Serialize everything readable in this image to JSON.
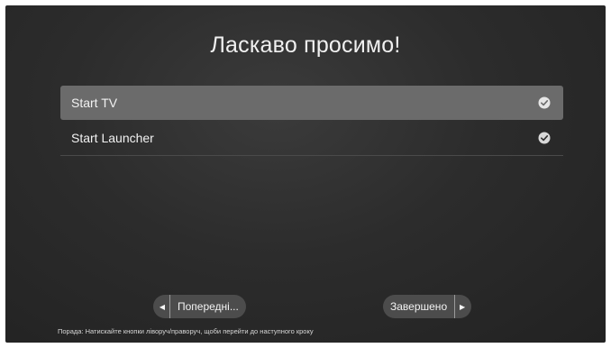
{
  "screen": {
    "title": "Ласкаво просимо!"
  },
  "options": [
    {
      "label": "Start TV",
      "focused": true
    },
    {
      "label": "Start Launcher",
      "focused": false
    }
  ],
  "navigation": {
    "previous_label": "Попередні...",
    "done_label": "Завершено"
  },
  "hint": "Порада: Натискайте кнопки ліворуч/праворуч, щоби перейти до наступного кроку",
  "icons": {
    "check": "check-circle-icon",
    "left": "arrow-left-icon",
    "right": "arrow-right-icon"
  }
}
